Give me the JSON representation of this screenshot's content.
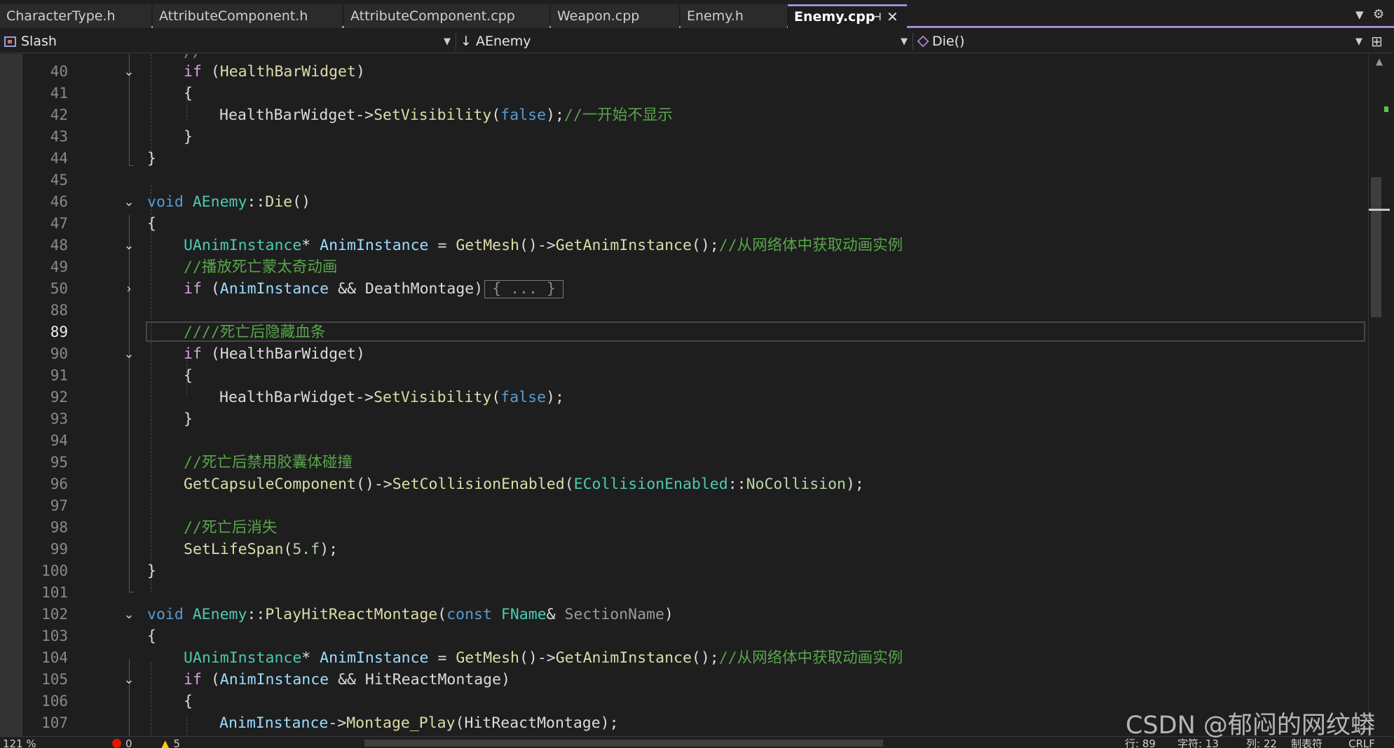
{
  "tabs": [
    {
      "label": "CharacterType.h"
    },
    {
      "label": "AttributeComponent.h"
    },
    {
      "label": "AttributeComponent.cpp"
    },
    {
      "label": "Weapon.cpp"
    },
    {
      "label": "Enemy.h"
    },
    {
      "label": "Enemy.cpp",
      "active": true
    }
  ],
  "nav": {
    "project": "Slash",
    "class_scope": "AEnemy",
    "member": "Die()"
  },
  "editor": {
    "current_line": "89",
    "lines": [
      {
        "num": "40",
        "text": "if (HealthBarWidget)"
      },
      {
        "num": "41",
        "text": "{"
      },
      {
        "num": "42",
        "text": "HealthBarWidget->SetVisibility(false);//一开始不显示"
      },
      {
        "num": "43",
        "text": "}"
      },
      {
        "num": "44",
        "text": "}"
      },
      {
        "num": "45",
        "text": ""
      },
      {
        "num": "46",
        "text": "void AEnemy::Die()"
      },
      {
        "num": "47",
        "text": "{"
      },
      {
        "num": "48",
        "text": "UAnimInstance* AnimInstance = GetMesh()->GetAnimInstance();//从网络体中获取动画实例"
      },
      {
        "num": "49",
        "text": "//播放死亡蒙太奇动画"
      },
      {
        "num": "50",
        "text": "if (AnimInstance && DeathMontage)"
      },
      {
        "num": "88",
        "text": ""
      },
      {
        "num": "89",
        "text": "////死亡后隐藏血条"
      },
      {
        "num": "90",
        "text": "if (HealthBarWidget)"
      },
      {
        "num": "91",
        "text": "{"
      },
      {
        "num": "92",
        "text": "HealthBarWidget->SetVisibility(false);"
      },
      {
        "num": "93",
        "text": "}"
      },
      {
        "num": "94",
        "text": ""
      },
      {
        "num": "95",
        "text": "//死亡后禁用胶囊体碰撞"
      },
      {
        "num": "96",
        "text": "GetCapsuleComponent()->SetCollisionEnabled(ECollisionEnabled::NoCollision);"
      },
      {
        "num": "97",
        "text": ""
      },
      {
        "num": "98",
        "text": "//死亡后消失"
      },
      {
        "num": "99",
        "text": "SetLifeSpan(5.f);"
      },
      {
        "num": "100",
        "text": "}"
      },
      {
        "num": "101",
        "text": ""
      },
      {
        "num": "102",
        "text": "void AEnemy::PlayHitReactMontage(const FName& SectionName)"
      },
      {
        "num": "103",
        "text": "{"
      },
      {
        "num": "104",
        "text": "UAnimInstance* AnimInstance = GetMesh()->GetAnimInstance();//从网络体中获取动画实例"
      },
      {
        "num": "105",
        "text": "if (AnimInstance && HitReactMontage)"
      },
      {
        "num": "106",
        "text": "{"
      },
      {
        "num": "107",
        "text": "AnimInstance->Montage_Play(HitReactMontage);"
      }
    ],
    "collapsed_placeholder": "{ ... }"
  },
  "status": {
    "zoom": "121 %",
    "errors": "0",
    "warnings": "5",
    "line": "行: 89",
    "char": "字符: 13",
    "col": "列: 22",
    "indent": "制表符",
    "eol": "CRLF"
  },
  "watermark": "CSDN @郁闷的网纹蟒",
  "icons": {
    "fold_expanded": "chevron-down-icon",
    "fold_collapsed": "chevron-right-icon",
    "pin": "pin-icon",
    "close": "close-icon",
    "settings": "gear-icon"
  },
  "colors": {
    "accent": "#a48ad8",
    "keyword": "#569cd6",
    "type": "#4ec9b0",
    "function": "#dcdcaa",
    "variable": "#9cdcfe",
    "comment": "#57a64a",
    "control": "#d8a0df"
  }
}
